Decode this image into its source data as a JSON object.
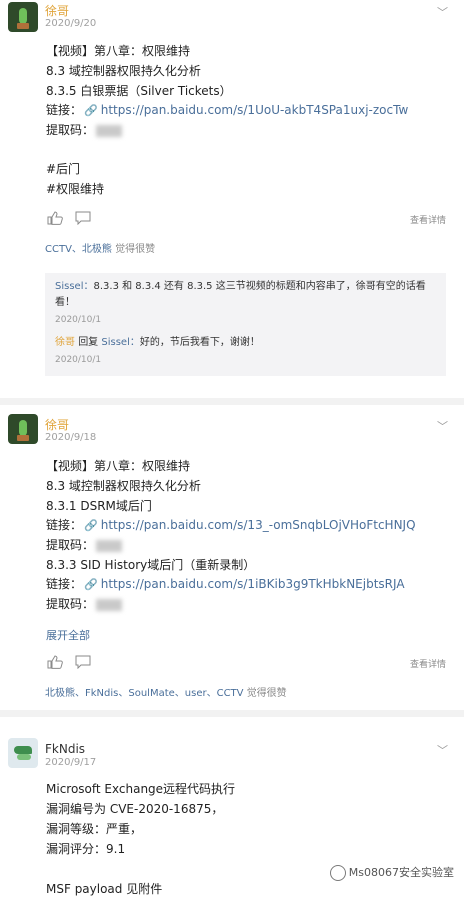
{
  "posts": [
    {
      "user": "徐哥",
      "date": "2020/9/20",
      "lines": [
        "【视频】第八章：权限维持",
        "8.3 域控制器权限持久化分析",
        "8.3.5 白银票据（Silver Tickets）"
      ],
      "link_label": "链接：",
      "link": "https://pan.baidu.com/s/1UoU-akbT4SPa1uxj-zocTw",
      "code_label": "提取码：",
      "tags": [
        "#后门",
        "#权限维持"
      ],
      "detail": "查看详情",
      "likers": "CCTV、北极熊",
      "likers_suffix": "觉得很赞",
      "comments": [
        {
          "name": "Sissel：",
          "text": "8.3.3 和 8.3.4 还有 8.3.5 这三节视频的标题和内容串了，徐哥有空的话看看！",
          "date": "2020/10/1"
        },
        {
          "name": "徐哥",
          "reply_word": "回复",
          "reply_to": "Sissel：",
          "text": "好的，节后我看下，谢谢！",
          "date": "2020/10/1"
        }
      ]
    },
    {
      "user": "徐哥",
      "date": "2020/9/18",
      "lines": [
        "【视频】第八章：权限维持",
        "8.3 域控制器权限持久化分析",
        "8.3.1 DSRM域后门"
      ],
      "link_label": "链接：",
      "link": "https://pan.baidu.com/s/13_-omSnqbLOjVHoFtcHNJQ",
      "code_label": "提取码：",
      "lines2": [
        "8.3.3 SID History域后门（重新录制）"
      ],
      "link2": "https://pan.baidu.com/s/1iBKib3g9TkHbkNEjbtsRJA",
      "more": "展开全部",
      "detail": "查看详情",
      "likers": "北极熊、FkNdis、SoulMate、user、CCTV",
      "likers_suffix": "觉得很赞"
    },
    {
      "user": "FkNdis",
      "date": "2020/9/17",
      "lines": [
        "Microsoft Exchange远程代码执行",
        "漏洞编号为 CVE-2020-16875，",
        "漏洞等级：严重，",
        "漏洞评分：9.1",
        "",
        "MSF payload 见附件"
      ]
    }
  ],
  "watermark": "Ms08067安全实验室",
  "icons": {
    "more": "chevron-down-icon",
    "link": "link-icon",
    "like": "thumb-up-icon",
    "comment": "comment-icon"
  },
  "colors": {
    "username": "#e0a43a",
    "link": "#4a6f9a",
    "comment_bg": "#f3f3f5"
  }
}
